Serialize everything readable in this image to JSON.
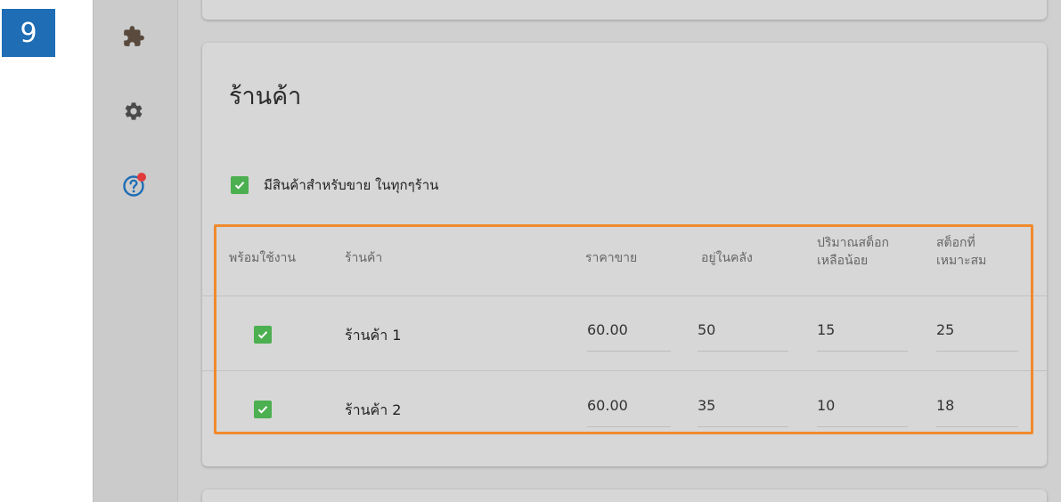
{
  "step_number": "9",
  "sidebar": {
    "icons": [
      "puzzle-icon",
      "gear-icon",
      "help-icon"
    ],
    "help_has_notification": true
  },
  "section": {
    "title": "ร้านค้า",
    "all_stores_checkbox": {
      "checked": true,
      "label": "มีสินค้าสำหรับขาย ในทุกๆร้าน"
    }
  },
  "table": {
    "headers": {
      "available": "พร้อมใช้งาน",
      "store": "ร้านค้า",
      "price": "ราคาขาย",
      "in_stock": "อยู่ในคลัง",
      "low_stock_1": "ปริมาณสต็อก",
      "low_stock_2": "เหลือน้อย",
      "optimal_stock_1": "สต็อกที่",
      "optimal_stock_2": "เหมาะสม"
    },
    "rows": [
      {
        "available": true,
        "store": "ร้านค้า 1",
        "price": "60.00",
        "in_stock": "50",
        "low_stock": "15",
        "optimal_stock": "25"
      },
      {
        "available": true,
        "store": "ร้านค้า 2",
        "price": "60.00",
        "in_stock": "35",
        "low_stock": "10",
        "optimal_stock": "18"
      }
    ]
  },
  "colors": {
    "highlight": "#f08a2c",
    "checkbox": "#4caf50",
    "badge": "#1e6db5",
    "notification": "#e23b3b"
  }
}
